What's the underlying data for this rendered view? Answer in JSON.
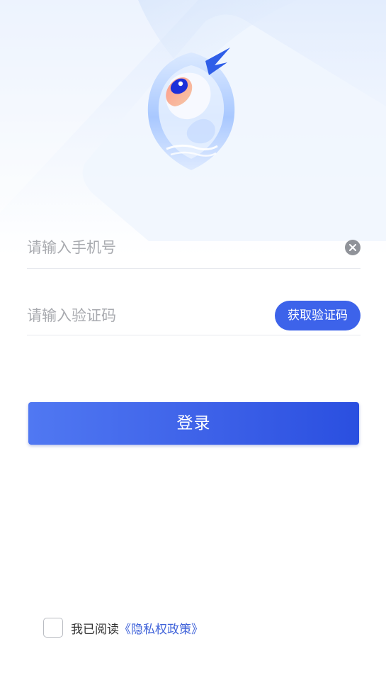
{
  "login_form": {
    "phone_placeholder": "请输入手机号",
    "code_placeholder": "请输入验证码",
    "get_code_label": "获取验证码",
    "submit_label": "登录"
  },
  "agreement": {
    "prefix": "我已阅读",
    "policy_link": "《隐私权政策》",
    "checked": false
  },
  "icons": {
    "clear": "clear-circle-icon",
    "logo": "app-logo-mascot"
  },
  "colors": {
    "accent": "#3d63ea",
    "link": "#3f62d9",
    "placeholder": "#a9abb0",
    "divider": "#e7e9ee"
  }
}
